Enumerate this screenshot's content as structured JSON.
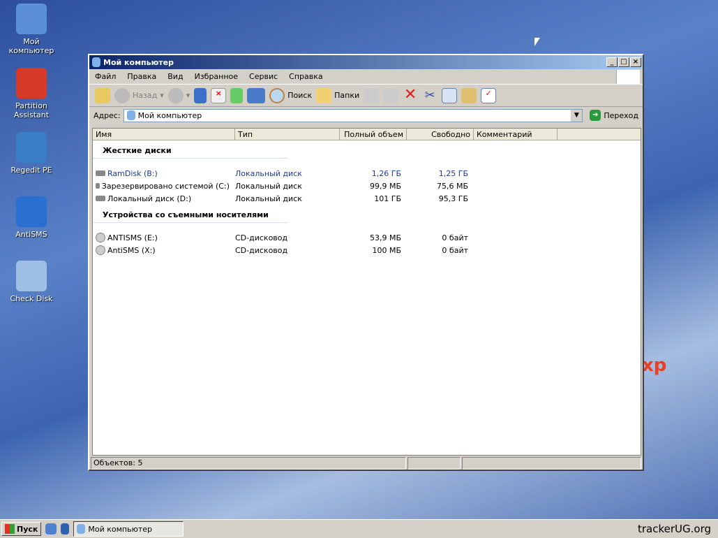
{
  "desktop": {
    "icons": [
      {
        "label": "Мой компьютер",
        "color": "#5b8fd6"
      },
      {
        "label": "Partition Assistant",
        "color": "#d83a2a"
      },
      {
        "label": "Regedit PE",
        "color": "#3a7fc6"
      },
      {
        "label": "AntiSMS",
        "color": "#2a6fd0"
      },
      {
        "label": "Check Disk",
        "color": "#9fbfe6"
      }
    ],
    "watermark_text": "xp"
  },
  "window": {
    "title": "Мой компьютер",
    "buttons": [
      "_",
      "□",
      "×"
    ],
    "menu": [
      "Файл",
      "Правка",
      "Вид",
      "Избранное",
      "Сервис",
      "Справка"
    ],
    "toolbar": {
      "back": "Назад",
      "search": "Поиск",
      "folders": "Папки"
    },
    "address": {
      "label": "Адрес:",
      "value": "Мой компьютер",
      "go": "Переход"
    },
    "columns": [
      "Имя",
      "Тип",
      "Полный объем",
      "Свободно",
      "Комментарий"
    ],
    "groups": [
      {
        "title": "Жесткие диски",
        "items": [
          {
            "name": "RamDisk (B:)",
            "type": "Локальный диск",
            "total": "1,26 ГБ",
            "free": "1,25 ГБ",
            "selected": true
          },
          {
            "name": "Зарезервировано системой (C:)",
            "type": "Локальный диск",
            "total": "99,9 МБ",
            "free": "75,6 МБ"
          },
          {
            "name": "Локальный диск (D:)",
            "type": "Локальный диск",
            "total": "101 ГБ",
            "free": "95,3 ГБ"
          }
        ]
      },
      {
        "title": "Устройства со съемными носителями",
        "items": [
          {
            "name": "ANTISMS (E:)",
            "type": "CD-дисковод",
            "total": "53,9 МБ",
            "free": "0 байт"
          },
          {
            "name": "AntiSMS (X:)",
            "type": "CD-дисковод",
            "total": "100 МБ",
            "free": "0 байт"
          }
        ]
      }
    ],
    "status": "Объектов: 5"
  },
  "taskbar": {
    "start": "Пуск",
    "task": "Мой компьютер",
    "watermark": "trackerUG.org"
  }
}
